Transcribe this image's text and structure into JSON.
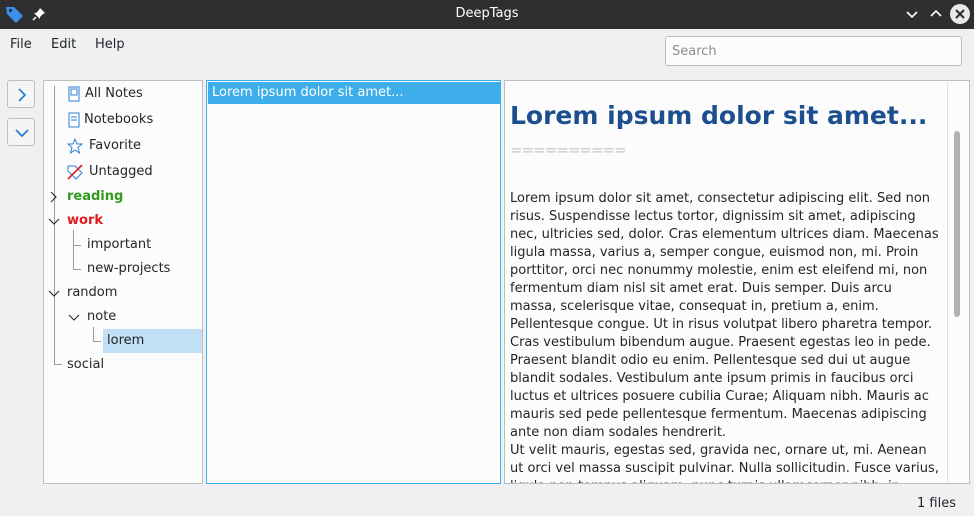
{
  "window": {
    "title": "DeepTags"
  },
  "menu": {
    "file": "File",
    "edit": "Edit",
    "help": "Help"
  },
  "search": {
    "placeholder": "Search"
  },
  "tree": {
    "all_notes": "All Notes",
    "notebooks": "Notebooks",
    "favorite": "Favorite",
    "untagged": "Untagged",
    "reading": "reading",
    "work": "work",
    "important": "important",
    "new_projects": "new-projects",
    "random": "random",
    "note": "note",
    "lorem": "lorem",
    "social": "social"
  },
  "notes_list": {
    "items": [
      "Lorem ipsum dolor sit amet..."
    ]
  },
  "preview": {
    "heading": "Lorem ipsum dolor sit amet...",
    "underline": "==========",
    "paragraph1": "Lorem ipsum dolor sit amet, consectetur adipiscing elit. Sed non risus. Suspendisse lectus tortor, dignissim sit amet, adipiscing nec, ultricies sed, dolor. Cras elementum ultrices diam. Maecenas ligula massa, varius a, semper congue, euismod non, mi. Proin porttitor, orci nec nonummy molestie, enim est eleifend mi, non fermentum diam nisl sit amet erat. Duis semper. Duis arcu massa, scelerisque vitae, consequat in, pretium a, enim. Pellentesque congue. Ut in risus volutpat libero pharetra tempor. Cras vestibulum bibendum augue. Praesent egestas leo in pede. Praesent blandit odio eu enim. Pellentesque sed dui ut augue blandit sodales. Vestibulum ante ipsum primis in faucibus orci luctus et ultrices posuere cubilia Curae; Aliquam nibh. Mauris ac mauris sed pede pellentesque fermentum. Maecenas adipiscing ante non diam sodales hendrerit.",
    "paragraph2": "Ut velit mauris, egestas sed, gravida nec, ornare ut, mi. Aenean ut orci vel massa suscipit pulvinar. Nulla sollicitudin. Fusce varius, ligula non tempus aliquam, nunc turpis ullamcorper nibh, in tempus sapien eros vitae ligula."
  },
  "status": {
    "files": "1 files"
  },
  "colors": {
    "accent": "#3daee9",
    "reading": "#2f9a1e",
    "work": "#e01b1b",
    "heading": "#1d4f8f"
  }
}
